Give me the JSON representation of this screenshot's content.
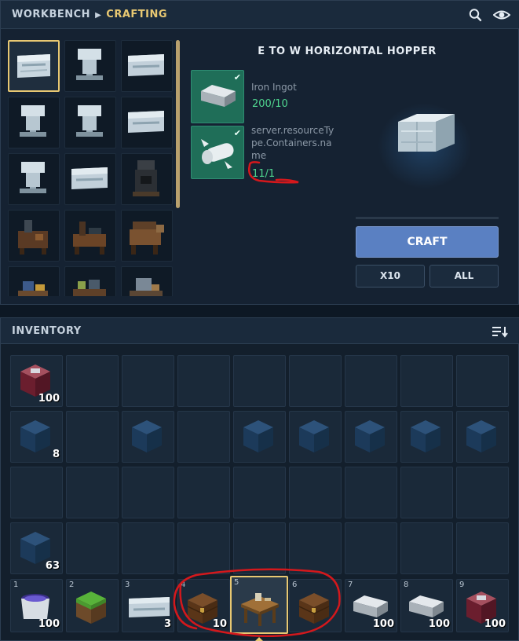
{
  "header": {
    "breadcrumb_root": "WORKBENCH",
    "breadcrumb_current": "CRAFTING",
    "search_icon": "search-icon",
    "visibility_icon": "eye-icon"
  },
  "recipe_list": {
    "items": [
      {
        "icon": "hopper-horizontal-icon",
        "selected": true
      },
      {
        "icon": "hopper-vertical-icon"
      },
      {
        "icon": "hopper-horizontal-icon"
      },
      {
        "icon": "hopper-vertical-icon"
      },
      {
        "icon": "hopper-vertical-icon"
      },
      {
        "icon": "hopper-horizontal-icon"
      },
      {
        "icon": "hopper-vertical-icon"
      },
      {
        "icon": "hopper-horizontal-icon"
      },
      {
        "icon": "furnace-icon"
      },
      {
        "icon": "workstation-icon"
      },
      {
        "icon": "workstation-icon"
      },
      {
        "icon": "workstation-icon"
      },
      {
        "icon": "workstation-icon"
      },
      {
        "icon": "workstation-icon"
      },
      {
        "icon": "workstation-icon"
      }
    ]
  },
  "recipe_detail": {
    "title": "E TO W HORIZONTAL HOPPER",
    "ingredients": [
      {
        "icon": "iron-ingot-icon",
        "name": "Iron Ingot",
        "count": "200/10"
      },
      {
        "icon": "wood-log-icon",
        "name": "server.resourceType.Containers.name",
        "count": "11/1"
      }
    ],
    "craft_label": "CRAFT",
    "x10_label": "X10",
    "all_label": "ALL"
  },
  "inventory": {
    "title": "INVENTORY",
    "sort_icon": "sort-icon",
    "rows": [
      [
        {
          "icon": "netherrack-block-icon",
          "qty": "100"
        },
        {},
        {},
        {},
        {},
        {},
        {},
        {},
        {}
      ],
      [
        {
          "icon": "blue-block-icon",
          "qty": "8"
        },
        {},
        {
          "icon": "blue-block-icon"
        },
        {},
        {
          "icon": "blue-block-icon"
        },
        {
          "icon": "blue-block-icon"
        },
        {
          "icon": "blue-block-icon"
        },
        {
          "icon": "blue-block-icon"
        },
        {
          "icon": "blue-block-icon"
        }
      ],
      [
        {},
        {},
        {},
        {},
        {},
        {},
        {},
        {},
        {}
      ],
      [
        {
          "icon": "blue-block-icon",
          "qty": "63"
        },
        {},
        {},
        {},
        {},
        {},
        {},
        {},
        {}
      ]
    ],
    "hotbar": [
      {
        "num": "1",
        "icon": "cauldron-icon",
        "qty": "100"
      },
      {
        "num": "2",
        "icon": "grass-block-icon",
        "qty": ""
      },
      {
        "num": "3",
        "icon": "hopper-horizontal-icon",
        "qty": "3"
      },
      {
        "num": "4",
        "icon": "chest-icon",
        "qty": "10"
      },
      {
        "num": "5",
        "icon": "crafting-table-icon",
        "qty": "",
        "active": true
      },
      {
        "num": "6",
        "icon": "chest-icon",
        "qty": ""
      },
      {
        "num": "7",
        "icon": "iron-ingot-icon",
        "qty": "100"
      },
      {
        "num": "8",
        "icon": "iron-ingot-icon",
        "qty": "100"
      },
      {
        "num": "9",
        "icon": "netherrack-block-icon",
        "qty": "100"
      }
    ]
  },
  "colors": {
    "accent": "#e8c872",
    "craft_button": "#5a80c2",
    "ingredient_ok": "#1f6e58",
    "count_ok": "#4fd58f",
    "annotation": "#d4181c"
  }
}
